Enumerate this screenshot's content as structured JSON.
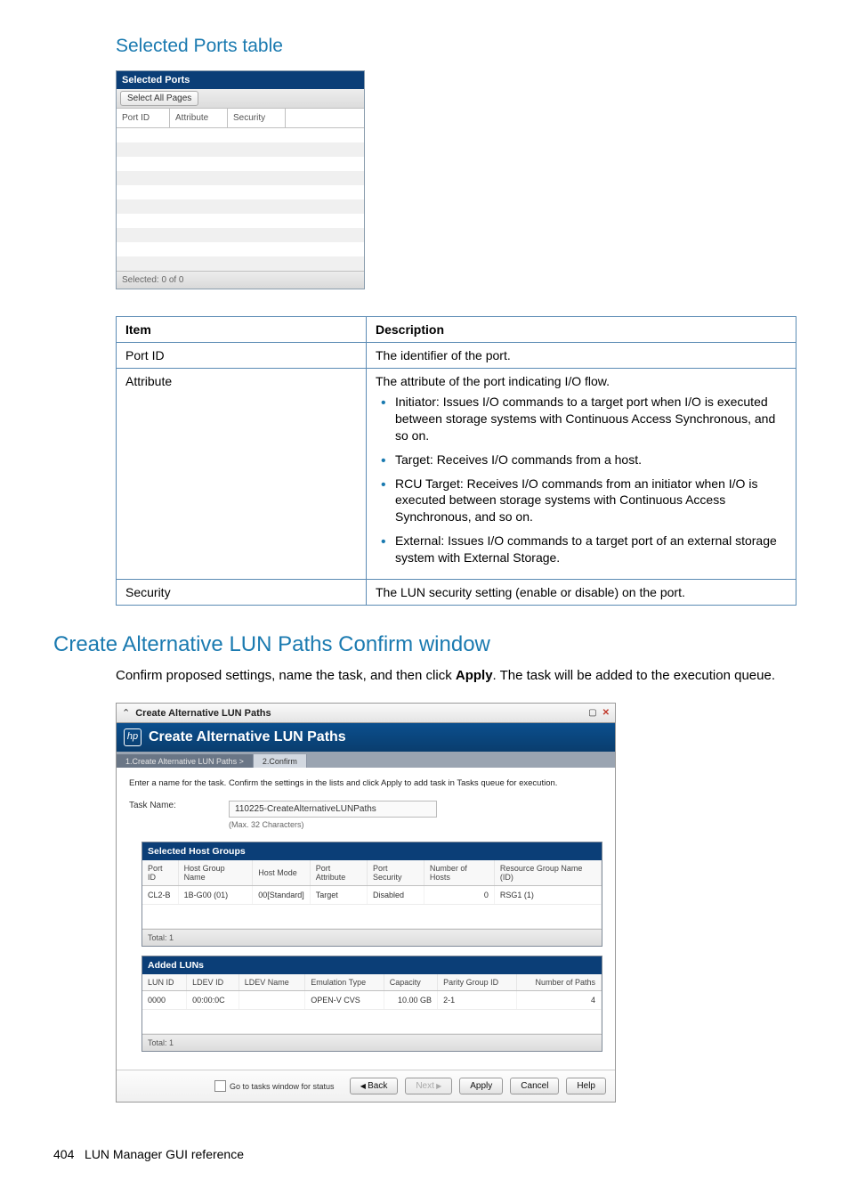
{
  "section1": {
    "title": "Selected Ports table",
    "widget": {
      "header": "Selected Ports",
      "select_all": "Select All Pages",
      "cols": [
        "Port ID",
        "Attribute",
        "Security"
      ],
      "footer": "Selected:  0    of  0"
    }
  },
  "desc_table": {
    "headers": [
      "Item",
      "Description"
    ],
    "row_port": {
      "item": "Port ID",
      "desc": "The identifier of the port."
    },
    "row_attr": {
      "item": "Attribute",
      "intro": "The attribute of the port indicating I/O flow.",
      "b1": "Initiator: Issues I/O commands to a target port when I/O is executed between storage systems with Continuous Access Synchronous, and so on.",
      "b2": "Target: Receives I/O commands from a host.",
      "b3": "RCU Target: Receives I/O commands from an initiator when I/O is executed between storage systems with Continuous Access Synchronous, and so on.",
      "b4": "External: Issues I/O commands to a target port of an external storage system with External Storage."
    },
    "row_sec": {
      "item": "Security",
      "desc": "The LUN security setting (enable or disable) on the port."
    }
  },
  "section2": {
    "title": "Create Alternative LUN Paths Confirm window",
    "body_pre": "Confirm proposed settings, name the task, and then click ",
    "body_bold": "Apply",
    "body_post": ". The task will be added to the execution queue."
  },
  "confirm": {
    "titlebar": "Create Alternative LUN Paths",
    "blue_header": "Create Alternative LUN Paths",
    "tabs": {
      "t1": "1.Create Alternative LUN Paths   >",
      "t2": "2.Confirm"
    },
    "instruction": "Enter a name for the task. Confirm the settings in the lists and click Apply to add task in Tasks queue for execution.",
    "task_label": "Task Name:",
    "task_value": "110225-CreateAlternativeLUNPaths",
    "task_hint": "(Max. 32 Characters)",
    "shg": {
      "title": "Selected Host Groups",
      "headers": [
        "Port ID",
        "Host Group Name",
        "Host Mode",
        "Port Attribute",
        "Port Security",
        "Number of Hosts",
        "Resource Group Name (ID)"
      ],
      "row": [
        "CL2-B",
        "1B-G00 (01)",
        "00[Standard]",
        "Target",
        "Disabled",
        "0",
        "RSG1 (1)"
      ],
      "footer": "Total:  1"
    },
    "luns": {
      "title": "Added LUNs",
      "headers": [
        "LUN ID",
        "LDEV ID",
        "LDEV Name",
        "Emulation Type",
        "Capacity",
        "Parity Group ID",
        "Number of Paths"
      ],
      "row": [
        "0000",
        "00:00:0C",
        "",
        "OPEN-V CVS",
        "10.00 GB",
        "2-1",
        "4"
      ],
      "footer": "Total:  1"
    },
    "footer": {
      "check_label": "Go to tasks window for status",
      "back": "Back",
      "next": "Next",
      "apply": "Apply",
      "cancel": "Cancel",
      "help": "Help"
    }
  },
  "page_footer": {
    "num": "404",
    "text": "LUN Manager GUI reference"
  }
}
